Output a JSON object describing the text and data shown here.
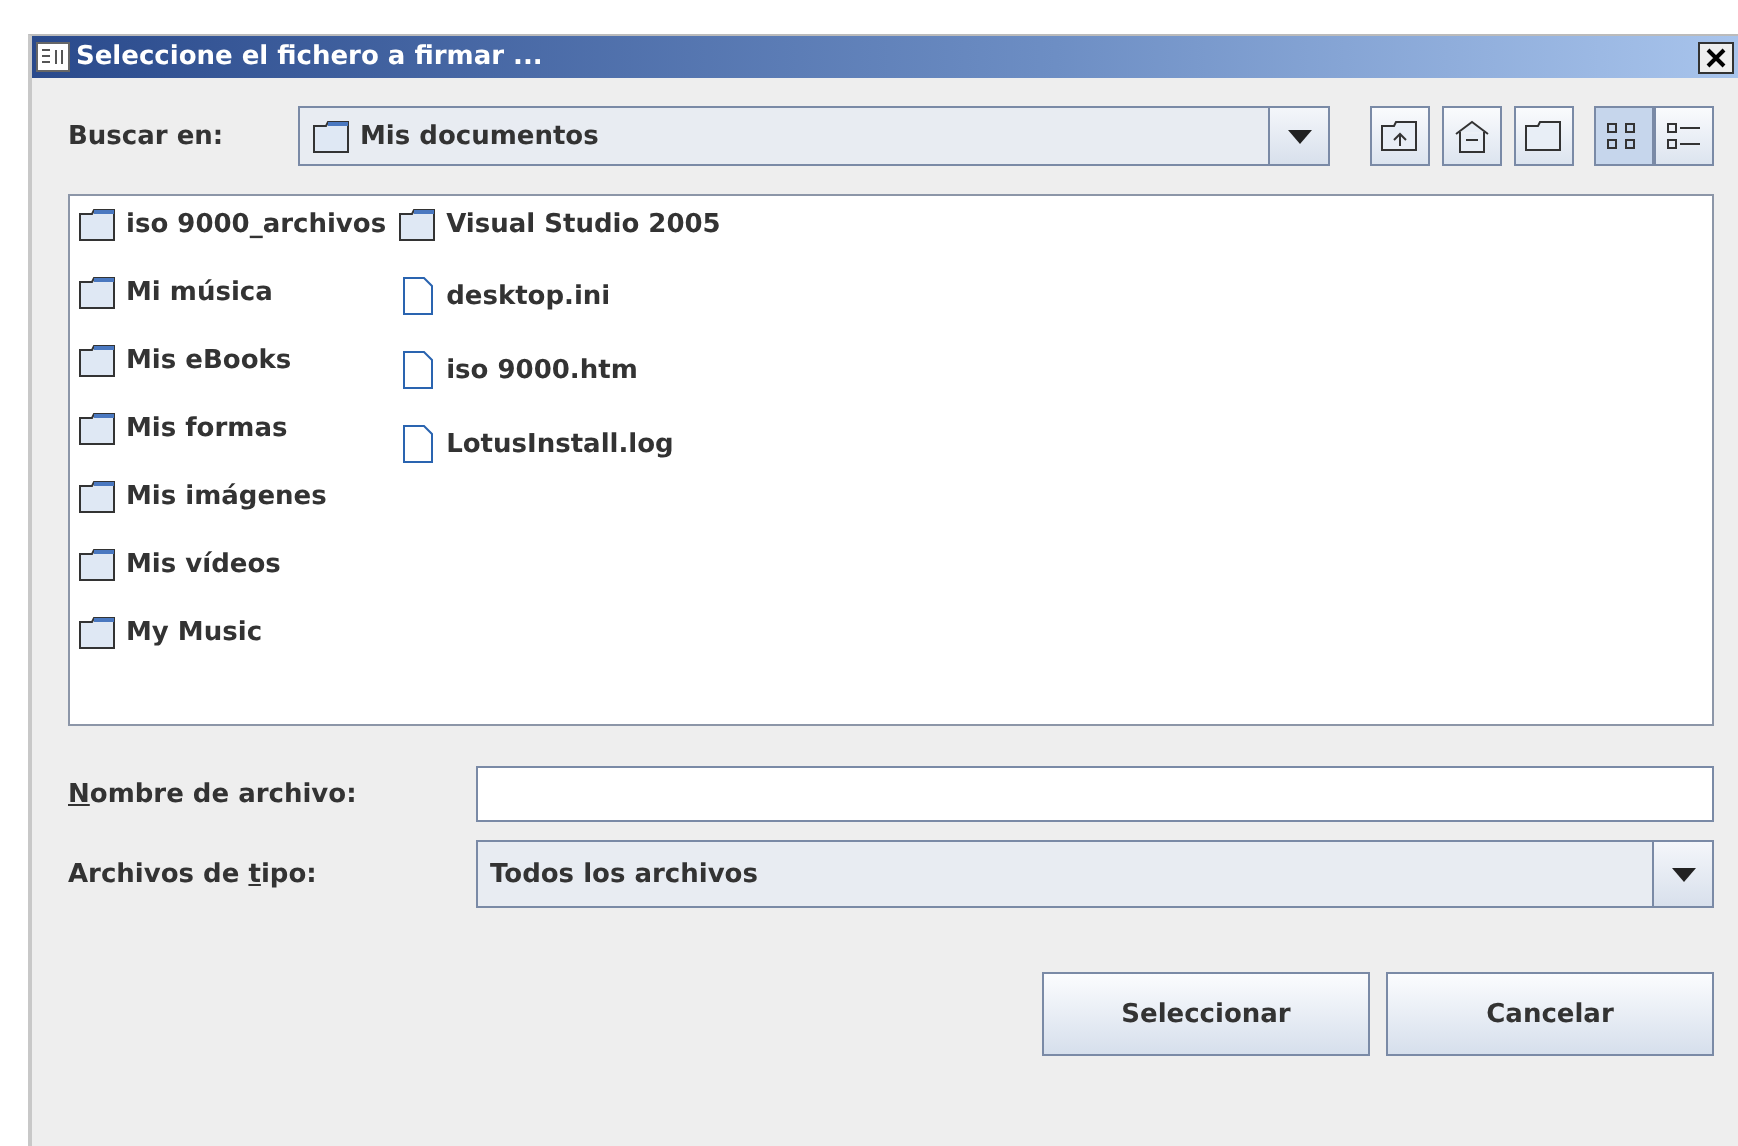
{
  "window": {
    "title": "Seleccione el fichero a firmar ..."
  },
  "look_in": {
    "label": "Buscar en:",
    "value": "Mis documentos"
  },
  "toolbar": [
    {
      "kind": "up",
      "selected": false
    },
    {
      "kind": "home",
      "selected": false
    },
    {
      "kind": "new-folder",
      "selected": false
    },
    {
      "kind": "list",
      "selected": true
    },
    {
      "kind": "details",
      "selected": false
    }
  ],
  "file_list": {
    "columns": [
      [
        {
          "name": "iso 9000_archivos",
          "kind": "folder"
        },
        {
          "name": "Mi música",
          "kind": "folder"
        },
        {
          "name": "Mis eBooks",
          "kind": "folder"
        },
        {
          "name": "Mis formas",
          "kind": "folder"
        },
        {
          "name": "Mis imágenes",
          "kind": "folder"
        },
        {
          "name": "Mis vídeos",
          "kind": "folder"
        },
        {
          "name": "My Music",
          "kind": "folder"
        }
      ],
      [
        {
          "name": "Visual Studio 2005",
          "kind": "folder"
        },
        {
          "name": "desktop.ini",
          "kind": "file"
        },
        {
          "name": "iso 9000.htm",
          "kind": "file"
        },
        {
          "name": "LotusInstall.log",
          "kind": "file"
        }
      ]
    ]
  },
  "file_name": {
    "label": {
      "key": "N",
      "after": "ombre de archivo:"
    }
  },
  "file_type": {
    "label": {
      "before": "Archivos de ",
      "key": "t",
      "after": "ipo:"
    },
    "value": "Todos los archivos"
  },
  "buttons": [
    "Seleccionar",
    "Cancelar"
  ]
}
